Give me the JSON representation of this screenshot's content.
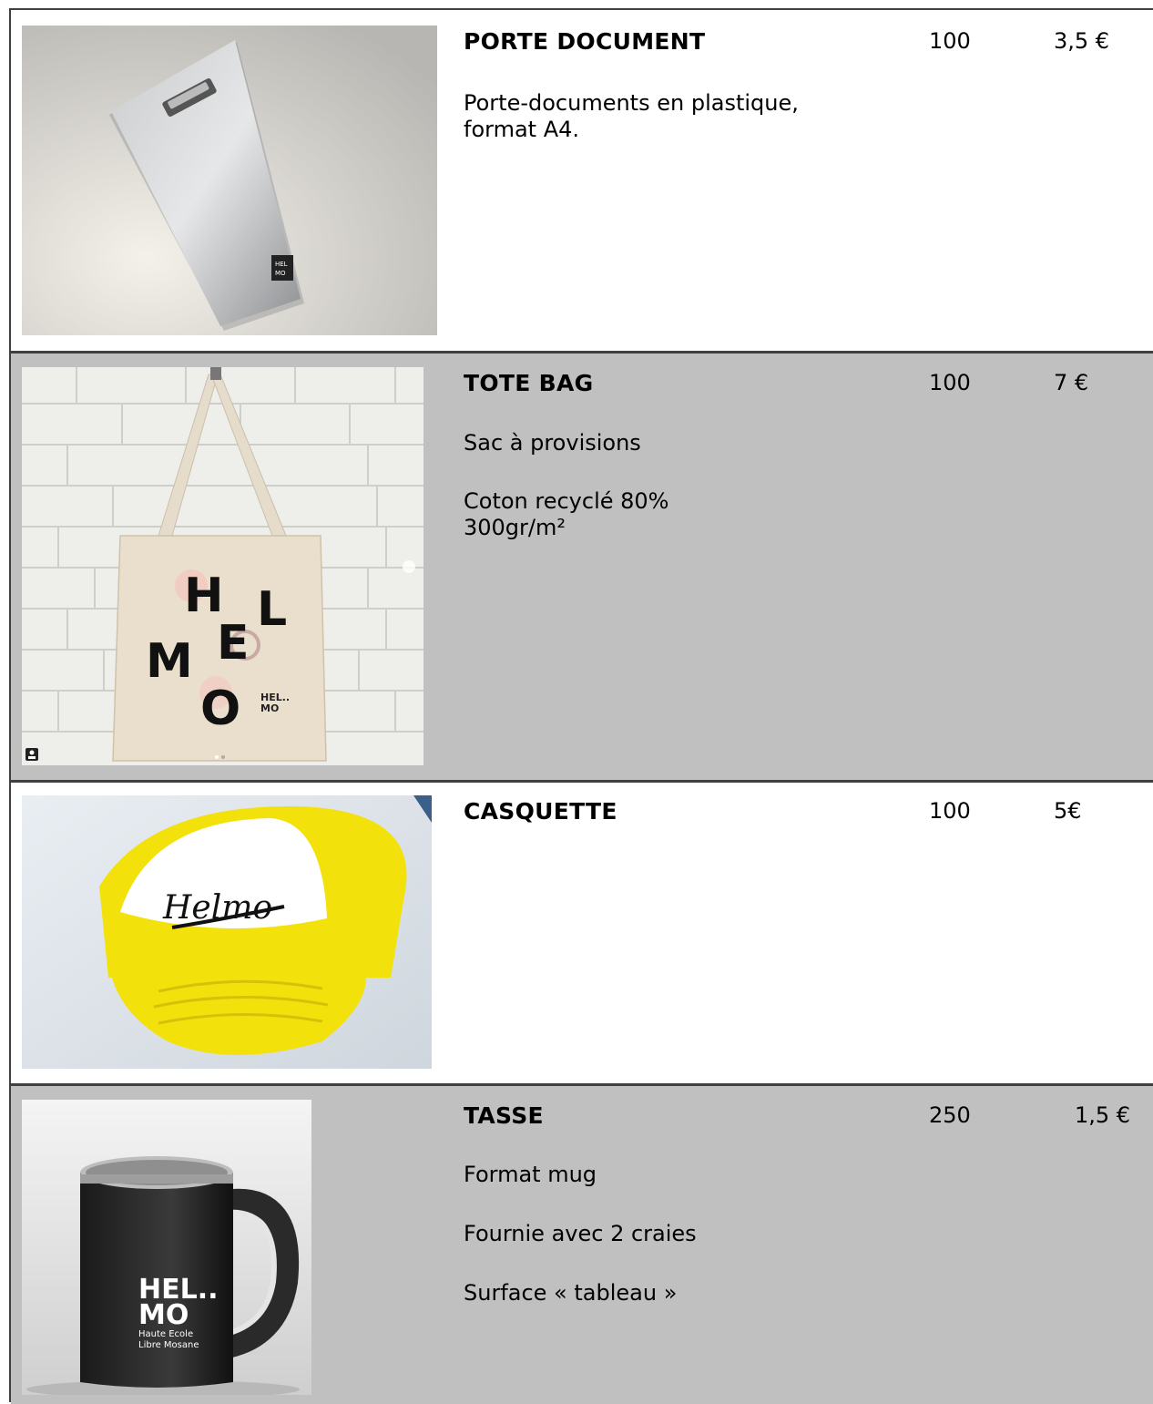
{
  "products": [
    {
      "title": "PORTE DOCUMENT",
      "quantity": "100",
      "price": "3,5 €",
      "description": [
        "Porte-documents en plastique,\nformat A4."
      ]
    },
    {
      "title": "TOTE BAG",
      "quantity": "100",
      "price": "7 €",
      "description": [
        "Sac à provisions",
        "Coton recyclé 80%\n300gr/m²"
      ],
      "print_letters": [
        "H",
        "L",
        "M",
        "E",
        "O"
      ],
      "logo_text": "HEL..\nMO"
    },
    {
      "title": "CASQUETTE",
      "quantity": "100",
      "price": "5€",
      "description": [],
      "logo_text": "Helmo"
    },
    {
      "title": "TASSE",
      "quantity": "250",
      "price": "1,5 €",
      "description": [
        "Format mug",
        "Fournie avec 2 craies",
        "Surface « tableau »"
      ],
      "logo_text": "HEL..\nMO",
      "logo_subtext": "Haute Ecole\nLibre Mosane"
    }
  ],
  "colors": {
    "row_gray": "#c0c0c0",
    "border": "#404040",
    "cap_yellow": "#f3e10c"
  }
}
